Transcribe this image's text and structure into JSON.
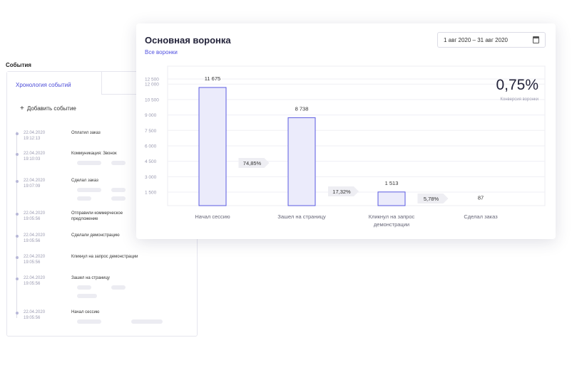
{
  "events": {
    "section_title": "События",
    "tab_label": "Хронология событий",
    "add_label": "Добавить событие",
    "items": [
      {
        "date": "22.04.2020",
        "time": "19:12:13",
        "title": "Оплатил заказ"
      },
      {
        "date": "22.04.2020",
        "time": "19:10:03",
        "title": "Коммуникация: Звонок"
      },
      {
        "date": "22.04.2020",
        "time": "19:07:09",
        "title": "Сделал заказ"
      },
      {
        "date": "22.04.2020",
        "time": "19:05:56",
        "title": "Отправили коммерческое предложение"
      },
      {
        "date": "22.04.2020",
        "time": "19:05:56",
        "title": "Сделали демонстрацию"
      },
      {
        "date": "22.04.2020",
        "time": "19:05:56",
        "title": "Кликнул на запрос демонстрации"
      },
      {
        "date": "22.04.2020",
        "time": "19:05:56",
        "title": "Зашел на страницу"
      },
      {
        "date": "22.04.2020",
        "time": "19:05:56",
        "title": "Начал сессию"
      }
    ]
  },
  "funnel": {
    "title": "Основная воронка",
    "all_funnels_link": "Все воронки",
    "date_range": "1 авг 2020 – 31 авг 2020",
    "conversion_value": "0,75%",
    "conversion_label": "Конверсия воронки"
  },
  "colors": {
    "accent": "#5151e0",
    "bar_fill": "#ebebfb",
    "bar_stroke": "#5a5ae0"
  },
  "chart_data": {
    "type": "bar",
    "categories": [
      "Начал сессию",
      "Зашел на страницу",
      "Кликнул на запрос демонстрации",
      "Сделал заказ"
    ],
    "values": [
      11675,
      8738,
      1513,
      87
    ],
    "value_labels": [
      "11 675",
      "8 738",
      "1 513",
      "87"
    ],
    "step_conversions": [
      "74,85%",
      "17,32%",
      "5,78%"
    ],
    "yticks": [
      1500,
      3000,
      4500,
      6000,
      7500,
      9000,
      10500,
      12000,
      12500
    ],
    "ytick_labels": [
      "1 500",
      "3 000",
      "4 500",
      "6 000",
      "7 500",
      "9 000",
      "10 500",
      "12 000",
      "12 500"
    ],
    "ylim": [
      0,
      12500
    ],
    "grid": true
  }
}
